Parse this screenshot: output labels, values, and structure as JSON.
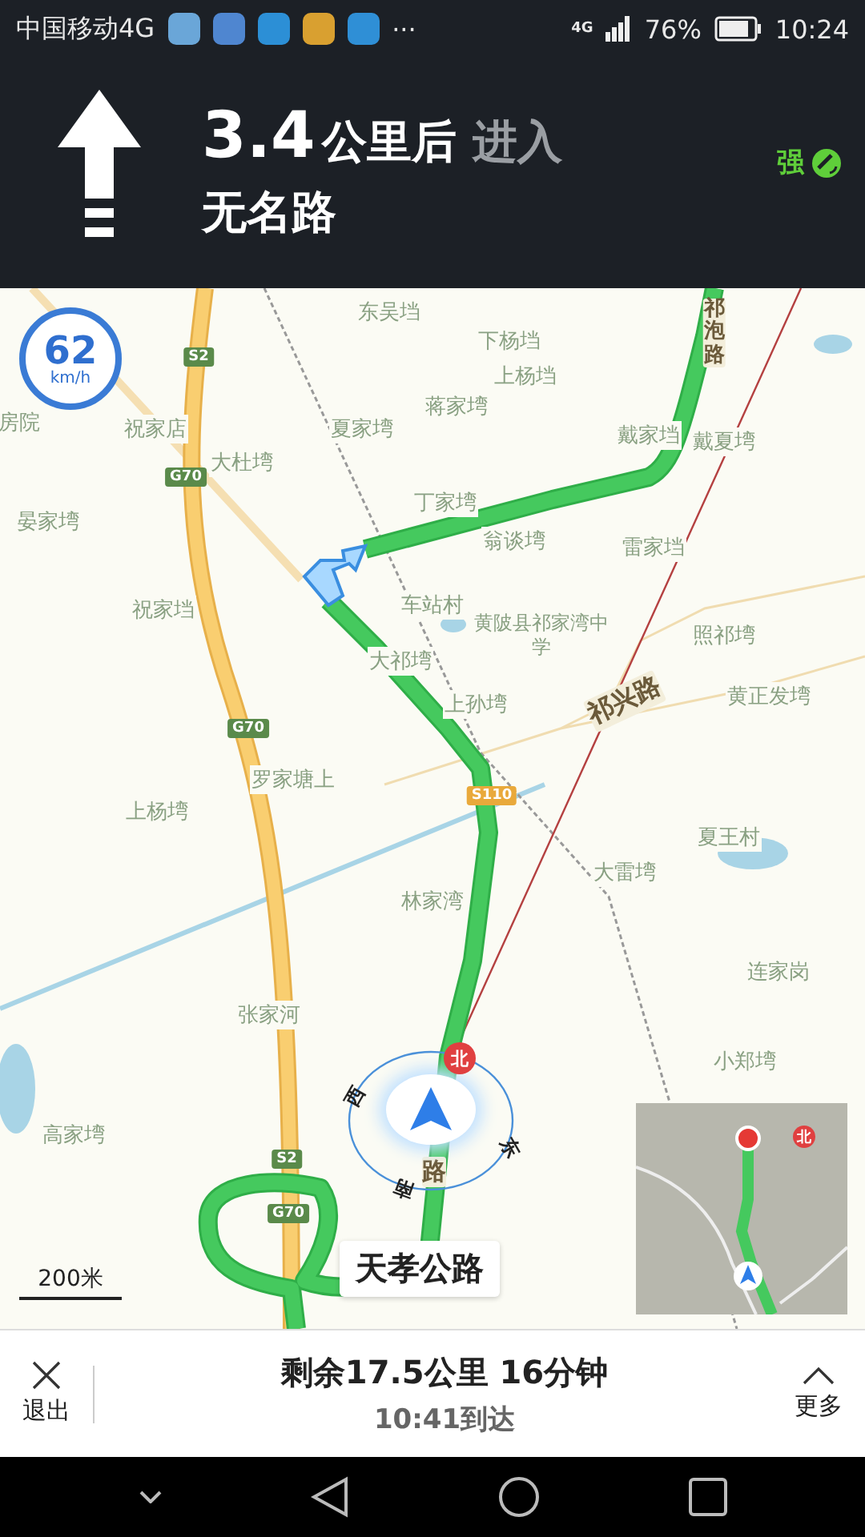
{
  "status_bar": {
    "carrier": "中国移动4G",
    "more": "···",
    "network": "4G",
    "battery": "76%",
    "time": "10:24"
  },
  "guidance": {
    "distance": "3.4",
    "unit": "公里后",
    "action": "进入",
    "road": "无名路",
    "gps_signal": "强"
  },
  "speed": {
    "value": "62",
    "unit": "km/h"
  },
  "map": {
    "places": [
      "东吴垱",
      "下杨垱",
      "上杨垱",
      "蒋家塆",
      "房院",
      "祝家店",
      "夏家塆",
      "戴家垱",
      "戴夏塆",
      "大杜塆",
      "丁家塆",
      "晏家塆",
      "翁谈塆",
      "雷家垱",
      "祝家垱",
      "车站村",
      "黄陂县祁家湾中学",
      "照祁塆",
      "大祁塆",
      "上孙塆",
      "黄正发塆",
      "罗家塘上",
      "上杨塆",
      "夏王村",
      "大雷塆",
      "林家湾",
      "连家岗",
      "张家河",
      "小郑塆",
      "高家塆"
    ],
    "road_names": [
      "祁泡路",
      "祁兴路",
      "路"
    ],
    "shields": [
      "S2",
      "G70",
      "G70",
      "S110",
      "S2",
      "G70"
    ],
    "compass": {
      "north": "北",
      "west": "西",
      "east": "东",
      "south": "南"
    },
    "scale": "200米",
    "current_road": "天孝公路",
    "minimap": {
      "north": "北"
    }
  },
  "bottom_bar": {
    "exit": "退出",
    "remaining": "剩余17.5公里 16分钟",
    "arrival": "10:41到达",
    "more": "更多"
  }
}
